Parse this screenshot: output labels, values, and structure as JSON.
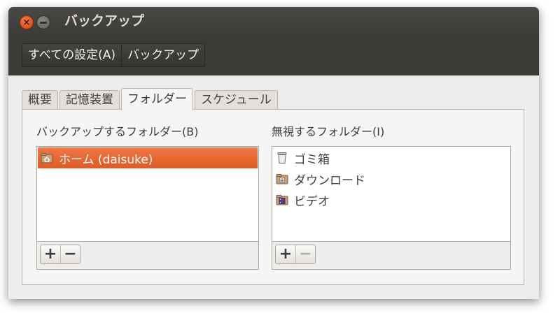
{
  "window": {
    "title": "バックアップ"
  },
  "breadcrumb": {
    "items": [
      "すべての設定(A)",
      "バックアップ"
    ]
  },
  "tabs": [
    {
      "label": "概要",
      "active": false
    },
    {
      "label": "記憶装置",
      "active": false
    },
    {
      "label": "フォルダー",
      "active": true
    },
    {
      "label": "スケジュール",
      "active": false
    }
  ],
  "backup_folders": {
    "label": "バックアップするフォルダー(B)",
    "items": [
      {
        "label": "ホーム (daisuke)",
        "icon": "home-folder-icon",
        "selected": true
      }
    ],
    "add_label": "+",
    "remove_label": "−"
  },
  "ignore_folders": {
    "label": "無視するフォルダー(I)",
    "items": [
      {
        "label": "ゴミ箱",
        "icon": "trash-icon"
      },
      {
        "label": "ダウンロード",
        "icon": "download-folder-icon"
      },
      {
        "label": "ビデオ",
        "icon": "video-folder-icon"
      }
    ],
    "add_label": "+",
    "remove_label": "−"
  },
  "colors": {
    "accent": "#e05b22",
    "titlebar": "#3c3b37"
  }
}
